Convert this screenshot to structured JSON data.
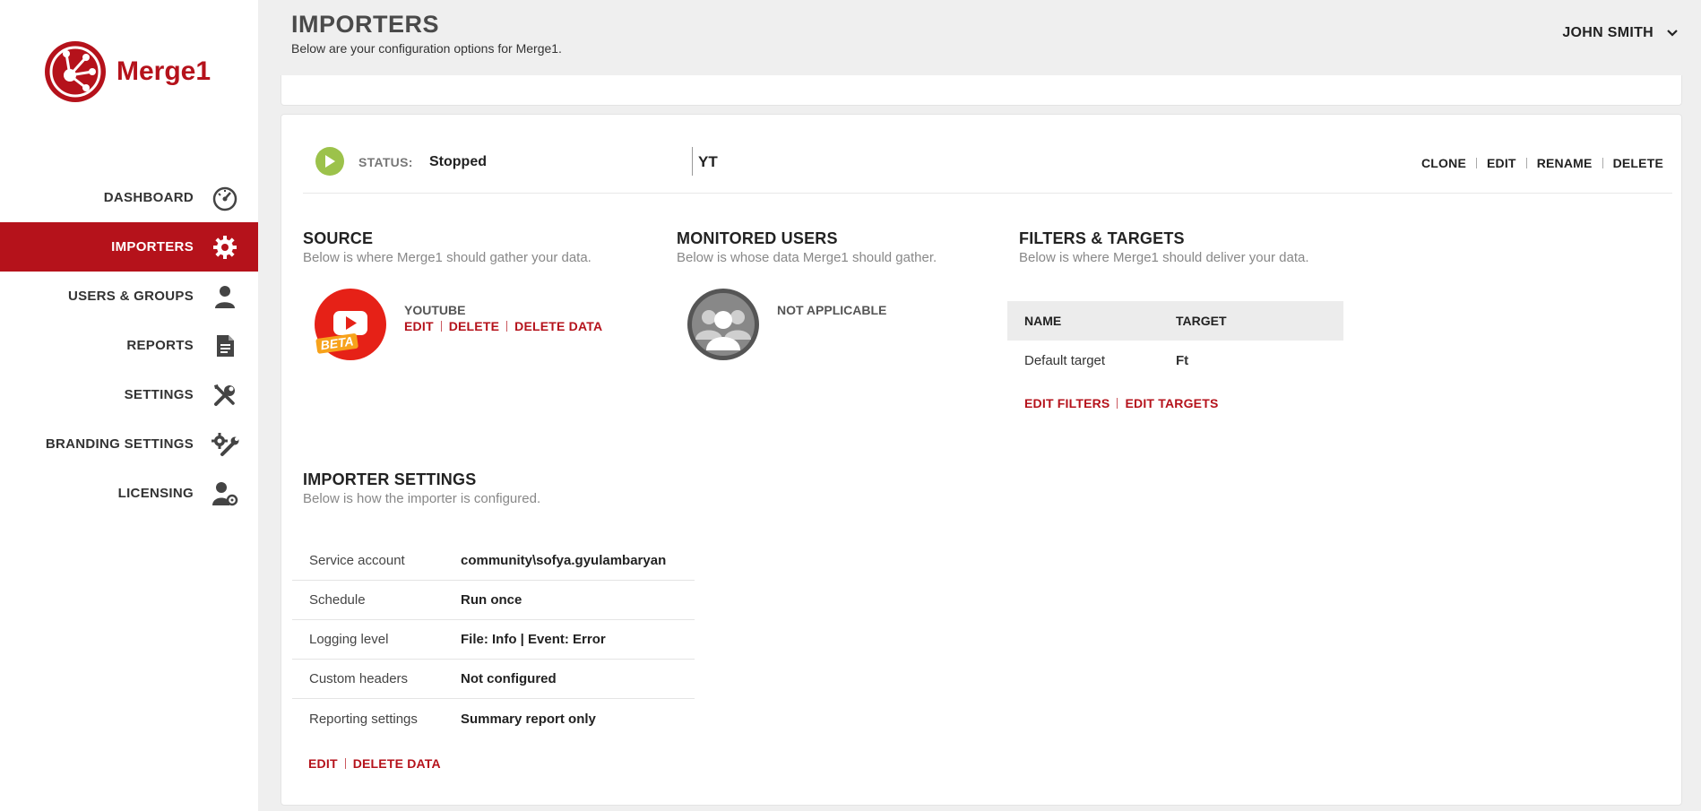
{
  "app": {
    "brand": "Merge1"
  },
  "colors": {
    "accent": "#b5121b",
    "play": "#9cc24b"
  },
  "sidebar": {
    "items": [
      {
        "label": "DASHBOARD",
        "icon": "speedometer-icon",
        "active": false
      },
      {
        "label": "IMPORTERS",
        "icon": "gear-icon",
        "active": true
      },
      {
        "label": "USERS & GROUPS",
        "icon": "user-icon",
        "active": false
      },
      {
        "label": "REPORTS",
        "icon": "document-icon",
        "active": false
      },
      {
        "label": "SETTINGS",
        "icon": "tools-icon",
        "active": false
      },
      {
        "label": "BRANDING SETTINGS",
        "icon": "gear-wrench-icon",
        "active": false
      },
      {
        "label": "LICENSING",
        "icon": "user-gear-icon",
        "active": false
      }
    ]
  },
  "header": {
    "title": "IMPORTERS",
    "subtitle": "Below are your configuration options for Merge1.",
    "user": "JOHN SMITH"
  },
  "importer": {
    "status_label": "STATUS:",
    "status_value": "Stopped",
    "name": "YT",
    "actions": [
      "CLONE",
      "EDIT",
      "RENAME",
      "DELETE"
    ]
  },
  "source": {
    "title": "SOURCE",
    "subtitle": "Below is where Merge1 should gather your data.",
    "name": "YOUTUBE",
    "badge": "BETA",
    "links": [
      "EDIT",
      "DELETE",
      "DELETE DATA"
    ]
  },
  "monitored_users": {
    "title": "MONITORED USERS",
    "subtitle": "Below is whose data Merge1 should gather.",
    "value": "NOT APPLICABLE"
  },
  "filters_targets": {
    "title": "FILTERS & TARGETS",
    "subtitle": "Below is where Merge1 should deliver your data.",
    "columns": [
      "NAME",
      "TARGET"
    ],
    "rows": [
      [
        "Default target",
        "Ft"
      ]
    ],
    "links": [
      "EDIT FILTERS",
      "EDIT TARGETS"
    ]
  },
  "importer_settings": {
    "title": "IMPORTER SETTINGS",
    "subtitle": "Below is how the importer is configured.",
    "rows": [
      {
        "label": "Service account",
        "value": "community\\sofya.gyulambaryan"
      },
      {
        "label": "Schedule",
        "value": "Run once"
      },
      {
        "label": "Logging level",
        "value": "File: Info | Event: Error"
      },
      {
        "label": "Custom headers",
        "value": "Not configured"
      },
      {
        "label": "Reporting settings",
        "value": "Summary report only"
      }
    ],
    "links": [
      "EDIT",
      "DELETE DATA"
    ]
  }
}
